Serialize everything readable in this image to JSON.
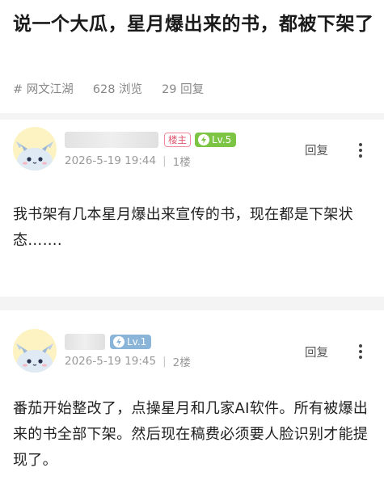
{
  "post": {
    "title": "说一个大瓜，星月爆出来的书，都被下架了",
    "board": "# 网文江湖",
    "views": "628 浏览",
    "replies": "29 回复"
  },
  "replies": [
    {
      "host_badge": "楼主",
      "level": "Lv.5",
      "level_color": "#7cc443",
      "time": "2026-5-19 19:44",
      "floor": "1楼",
      "reply_label": "回复",
      "content": "我书架有几本星月爆出来宣传的书，现在都是下架状态……."
    },
    {
      "level": "Lv.1",
      "level_color": "#8ab4d8",
      "time": "2026-5-19 19:45",
      "floor": "2楼",
      "reply_label": "回复",
      "content": "番茄开始整改了，点操星月和几家AI软件。所有被爆出来的书全部下架。然后现在稿费必须要人脸识别才能提现了。"
    }
  ],
  "icons": {
    "more": "more-vertical-icon",
    "level": "lightning-icon",
    "avatar": "dragon-avatar-icon"
  }
}
